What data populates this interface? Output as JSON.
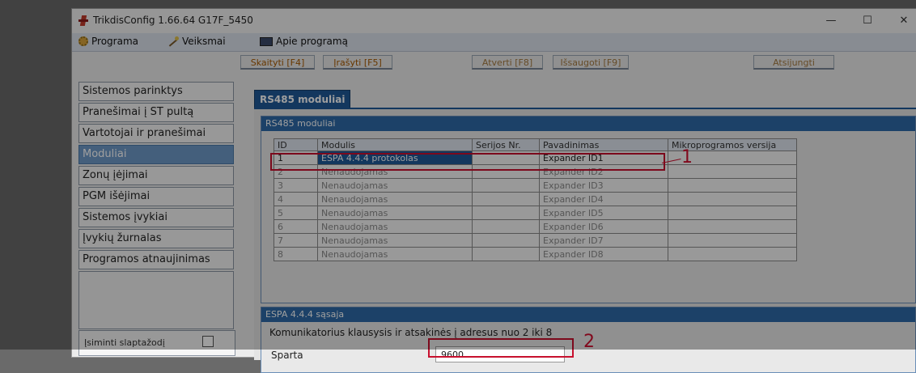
{
  "window": {
    "title": "TrikdisConfig 1.66.64   G17F_5450",
    "controls": {
      "minimize": "—",
      "maximize": "☐",
      "close": "✕"
    }
  },
  "menu": [
    {
      "label": "Programa",
      "icon": "gear-icon"
    },
    {
      "label": "Veiksmai",
      "icon": "wand-icon"
    },
    {
      "label": "Apie programą",
      "icon": "book-icon"
    }
  ],
  "toolbar": {
    "read": "Skaityti [F4]",
    "write": "Įrašyti [F5]",
    "open": "Atverti [F8]",
    "save": "Išsaugoti [F9]",
    "disconnect": "Atsijungti"
  },
  "nav": [
    "Sistemos parinktys",
    "Pranešimai į ST pultą",
    "Vartotojai ir pranešimai",
    "Moduliai",
    "Zonų įėjimai",
    "PGM išėjimai",
    "Sistemos įvykiai",
    "Įvykių žurnalas",
    "Programos atnaujinimas"
  ],
  "remember": {
    "label": "Įsiminti slaptažodį",
    "checked": false
  },
  "tab": {
    "label": "RS485 moduliai"
  },
  "modules_group": {
    "header": "RS485 moduliai",
    "columns": [
      "ID",
      "Modulis",
      "Serijos Nr.",
      "Pavadinimas",
      "Mikroprogramos versija"
    ],
    "rows": [
      {
        "id": "1",
        "module": "ESPA 4.4.4 protokolas",
        "serial": "",
        "name": "Expander ID1",
        "firmware": ""
      },
      {
        "id": "2",
        "module": "Nenaudojamas",
        "serial": "",
        "name": "Expander ID2",
        "firmware": ""
      },
      {
        "id": "3",
        "module": "Nenaudojamas",
        "serial": "",
        "name": "Expander ID3",
        "firmware": ""
      },
      {
        "id": "4",
        "module": "Nenaudojamas",
        "serial": "",
        "name": "Expander ID4",
        "firmware": ""
      },
      {
        "id": "5",
        "module": "Nenaudojamas",
        "serial": "",
        "name": "Expander ID5",
        "firmware": ""
      },
      {
        "id": "6",
        "module": "Nenaudojamas",
        "serial": "",
        "name": "Expander ID6",
        "firmware": ""
      },
      {
        "id": "7",
        "module": "Nenaudojamas",
        "serial": "",
        "name": "Expander ID7",
        "firmware": ""
      },
      {
        "id": "8",
        "module": "Nenaudojamas",
        "serial": "",
        "name": "Expander ID8",
        "firmware": ""
      }
    ]
  },
  "espa_group": {
    "header": "ESPA 4.4.4 sąsaja",
    "description": "Komunikatorius klausysis ir atsakinės į adresus nuo 2 iki 8",
    "speed_label": "Sparta",
    "speed_value": "9600"
  },
  "annotations": {
    "one": "1",
    "two": "2"
  },
  "colors": {
    "accent": "#1f5a98",
    "annotation": "#d01030",
    "nav_active": "#6f9ac8"
  }
}
